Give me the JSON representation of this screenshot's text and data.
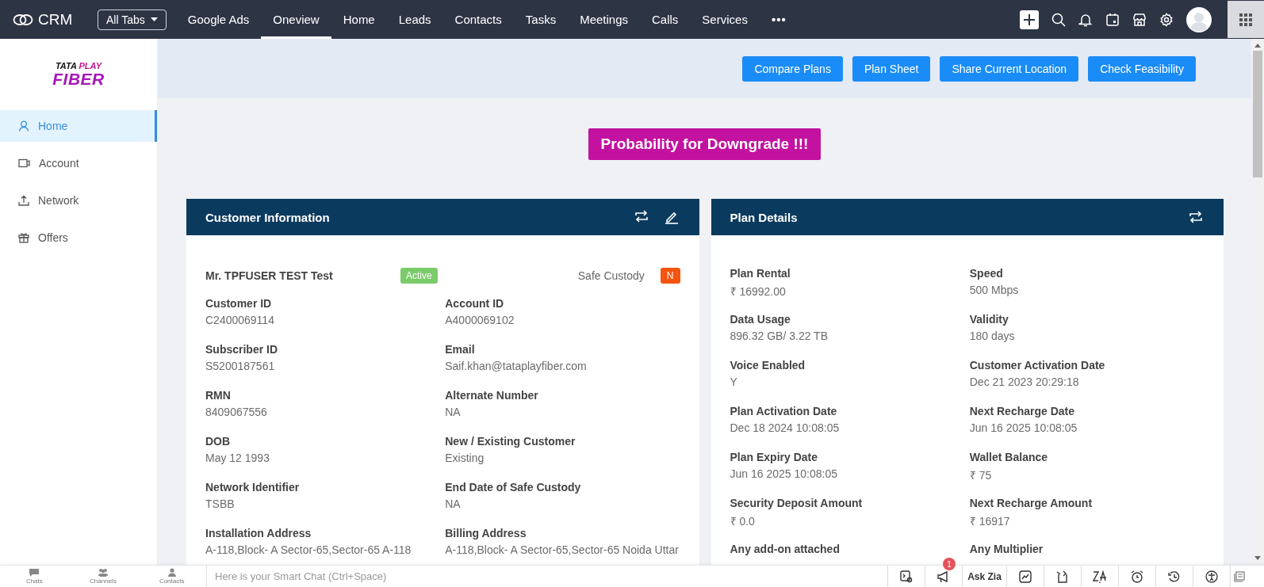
{
  "topbar": {
    "app_name": "CRM",
    "all_tabs": "All Tabs",
    "tabs": [
      {
        "label": "Google Ads",
        "selected": false
      },
      {
        "label": "Oneview",
        "selected": true
      },
      {
        "label": "Home",
        "selected": false
      },
      {
        "label": "Leads",
        "selected": false
      },
      {
        "label": "Contacts",
        "selected": false
      },
      {
        "label": "Tasks",
        "selected": false
      },
      {
        "label": "Meetings",
        "selected": false
      },
      {
        "label": "Calls",
        "selected": false
      },
      {
        "label": "Services",
        "selected": false
      }
    ],
    "more": "•••"
  },
  "sidebar": {
    "logo": {
      "word_1": "TATA",
      "word_2": "PLAY",
      "word_3": "FIBER"
    },
    "items": [
      {
        "label": "Home",
        "selected": true
      },
      {
        "label": "Account",
        "selected": false
      },
      {
        "label": "Network",
        "selected": false
      },
      {
        "label": "Offers",
        "selected": false
      }
    ]
  },
  "actions": [
    "Compare Plans",
    "Plan Sheet",
    "Share Current Location",
    "Check Feasibility"
  ],
  "alert_banner": "Probability for Downgrade !!!",
  "customer_card": {
    "title": "Customer Information",
    "customer_name": "Mr. TPFUSER TEST Test",
    "status": "Active",
    "safe_custody_label": "Safe Custody",
    "safe_custody_value": "N",
    "fields": [
      {
        "label": "Customer ID",
        "value": "C2400069114"
      },
      {
        "label": "Account ID",
        "value": "A4000069102"
      },
      {
        "label": "Subscriber ID",
        "value": "S5200187561"
      },
      {
        "label": "Email",
        "value": "Saif.khan@tataplayfiber.com"
      },
      {
        "label": "RMN",
        "value": "8409067556"
      },
      {
        "label": "Alternate Number",
        "value": "NA"
      },
      {
        "label": "DOB",
        "value": "May 12 1993"
      },
      {
        "label": "New / Existing Customer",
        "value": "Existing"
      },
      {
        "label": "Network Identifier",
        "value": "TSBB"
      },
      {
        "label": "End Date of Safe Custody",
        "value": "NA"
      },
      {
        "label": "Installation Address",
        "value": "A-118,Block- A Sector-65,Sector-65 A-118"
      },
      {
        "label": "Billing Address",
        "value": "A-118,Block- A Sector-65,Sector-65 Noida Uttar"
      }
    ]
  },
  "plan_card": {
    "title": "Plan Details",
    "fields": [
      {
        "label": "Plan Rental",
        "value": "₹ 16992.00"
      },
      {
        "label": "Speed",
        "value": "500 Mbps"
      },
      {
        "label": "Data Usage",
        "value": "896.32 GB/ 3.22 TB"
      },
      {
        "label": "Validity",
        "value": "180 days"
      },
      {
        "label": "Voice Enabled",
        "value": "Y"
      },
      {
        "label": "Customer Activation Date",
        "value": "Dec 21 2023 20:29:18"
      },
      {
        "label": "Plan Activation Date",
        "value": "Dec 18 2024 10:08:05"
      },
      {
        "label": "Next Recharge Date",
        "value": "Jun 16 2025 10:08:05"
      },
      {
        "label": "Plan Expiry Date",
        "value": "Jun 16 2025 10:08:05"
      },
      {
        "label": "Wallet Balance",
        "value": "₹ 75"
      },
      {
        "label": "Security Deposit Amount",
        "value": "₹ 0.0"
      },
      {
        "label": "Next Recharge Amount",
        "value": "₹ 16917"
      },
      {
        "label": "Any add-on attached"
      },
      {
        "label": "Any Multiplier"
      }
    ]
  },
  "chat_bar": {
    "shortcuts": [
      "Chats",
      "Channels",
      "Contacts"
    ],
    "placeholder": "Here is your Smart Chat (Ctrl+Space)",
    "notification_count": "1",
    "ask_zia": "Ask Zia"
  }
}
